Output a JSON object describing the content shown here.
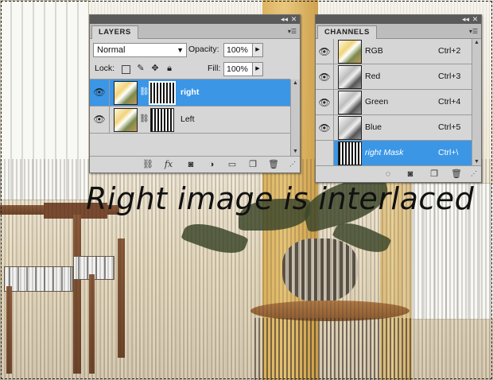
{
  "caption": "Right image is interlaced",
  "layers_panel": {
    "tab": "LAYERS",
    "blend_mode": "Normal",
    "opacity_label": "Opacity:",
    "opacity_value": "100%",
    "lock_label": "Lock:",
    "fill_label": "Fill:",
    "fill_value": "100%",
    "layers": [
      {
        "name": "right",
        "visible": true,
        "selected": true
      },
      {
        "name": "Left",
        "visible": true,
        "selected": false
      }
    ]
  },
  "channels_panel": {
    "tab": "CHANNELS",
    "channels": [
      {
        "name": "RGB",
        "shortcut": "Ctrl+2",
        "visible": true,
        "selected": false
      },
      {
        "name": "Red",
        "shortcut": "Ctrl+3",
        "visible": true,
        "selected": false
      },
      {
        "name": "Green",
        "shortcut": "Ctrl+4",
        "visible": true,
        "selected": false
      },
      {
        "name": "Blue",
        "shortcut": "Ctrl+5",
        "visible": true,
        "selected": false
      },
      {
        "name": "right Mask",
        "shortcut": "Ctrl+\\",
        "visible": false,
        "selected": true
      }
    ]
  },
  "colors": {
    "selection_highlight": "#3b96e6",
    "panel_bg": "#d6d6d6",
    "panel_titlebar": "#5a5a5a"
  },
  "icons": {
    "eye": "eye-icon",
    "link": "link-icon",
    "fx": "fx-icon",
    "mask": "add-mask-icon",
    "adjustment": "adjustment-layer-icon",
    "folder": "folder-icon",
    "new": "new-layer-icon",
    "trash": "trash-icon"
  }
}
